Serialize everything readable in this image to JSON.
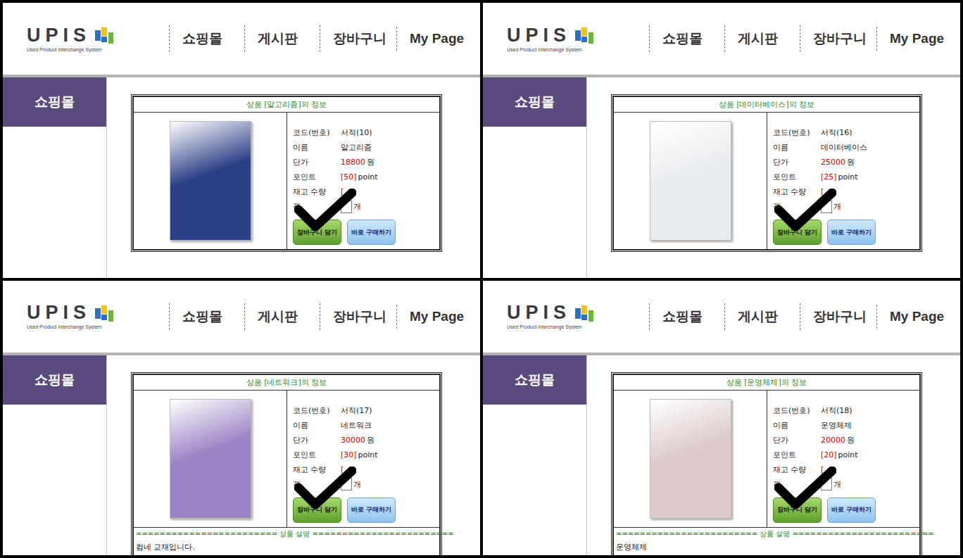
{
  "header": {
    "logo": {
      "name": "UPIS",
      "subtitle": "Used Product Interchange System"
    },
    "nav": [
      "쇼핑몰",
      "게시판",
      "장바구니",
      "My Page"
    ]
  },
  "sidebar": {
    "title": "쇼핑몰"
  },
  "panels": [
    {
      "title": "상품 [알고리즘]의 정보",
      "cover_color": "#2b3f86",
      "checkmark": true,
      "fields": [
        {
          "label": "코드(번호)",
          "value": "서적(10)",
          "kind": "text"
        },
        {
          "label": "이름",
          "value": "알고리즘",
          "kind": "text"
        },
        {
          "label": "단가",
          "value": "18800",
          "unit": "원",
          "kind": "price"
        },
        {
          "label": "포인트",
          "value": "[50]",
          "unit": "point",
          "kind": "point"
        },
        {
          "label": "재고 수량",
          "value": "[",
          "kind": "stock"
        },
        {
          "label": "갯",
          "unit": "개",
          "kind": "quantity"
        }
      ],
      "buttons": [
        {
          "label": "장바구니 담기",
          "kind": "cart"
        },
        {
          "label": "바로 구매하기",
          "kind": "buy"
        }
      ],
      "description": null
    },
    {
      "title": "상품 [데이터베이스]의 정보",
      "cover_color": "#e9ecef",
      "checkmark": true,
      "fields": [
        {
          "label": "코드(번호)",
          "value": "서적(16)",
          "kind": "text"
        },
        {
          "label": "이름",
          "value": "데이터베이스",
          "kind": "text"
        },
        {
          "label": "단가",
          "value": "25000",
          "unit": "원",
          "kind": "price"
        },
        {
          "label": "포인트",
          "value": "[25]",
          "unit": "point",
          "kind": "point"
        },
        {
          "label": "재고 수량",
          "value": "[",
          "kind": "stock"
        },
        {
          "label": "갯",
          "unit": "개",
          "kind": "quantity"
        }
      ],
      "buttons": [
        {
          "label": "장바구니 담기",
          "kind": "cart"
        },
        {
          "label": "바로 구매하기",
          "kind": "buy"
        }
      ],
      "description": null
    },
    {
      "title": "상품 [네트워크]의 정보",
      "cover_color": "#9b82c4",
      "checkmark": true,
      "fields": [
        {
          "label": "코드(번호)",
          "value": "서적(17)",
          "kind": "text"
        },
        {
          "label": "이름",
          "value": "네트워크",
          "kind": "text"
        },
        {
          "label": "단가",
          "value": "30000",
          "unit": "원",
          "kind": "price"
        },
        {
          "label": "포인트",
          "value": "[30]",
          "unit": "point",
          "kind": "point"
        },
        {
          "label": "재고 수량",
          "value": "[",
          "kind": "stock"
        },
        {
          "label": "갯",
          "unit": "개",
          "kind": "quantity"
        }
      ],
      "buttons": [
        {
          "label": "장바구니 담기",
          "kind": "cart"
        },
        {
          "label": "바로 구매하기",
          "kind": "buy"
        }
      ],
      "description": {
        "header": "======================== 상품 설명 ========================",
        "text": "컴네 교재입니다."
      }
    },
    {
      "title": "상품 [운영체제]의 정보",
      "cover_color": "#dcc9c9",
      "checkmark": true,
      "fields": [
        {
          "label": "코드(번호)",
          "value": "서적(18)",
          "kind": "text"
        },
        {
          "label": "이름",
          "value": "운영체제",
          "kind": "text"
        },
        {
          "label": "단가",
          "value": "20000",
          "unit": "원",
          "kind": "price"
        },
        {
          "label": "포인트",
          "value": "[20]",
          "unit": "point",
          "kind": "point"
        },
        {
          "label": "재고 수량",
          "value": "[",
          "kind": "stock"
        },
        {
          "label": "갯",
          "unit": "개",
          "kind": "quantity"
        }
      ],
      "buttons": [
        {
          "label": "장바구니 담기",
          "kind": "cart"
        },
        {
          "label": "바로 구매하기",
          "kind": "buy"
        }
      ],
      "description": {
        "header": "======================== 상품 설명 ========================",
        "text": "운영체제"
      }
    }
  ]
}
